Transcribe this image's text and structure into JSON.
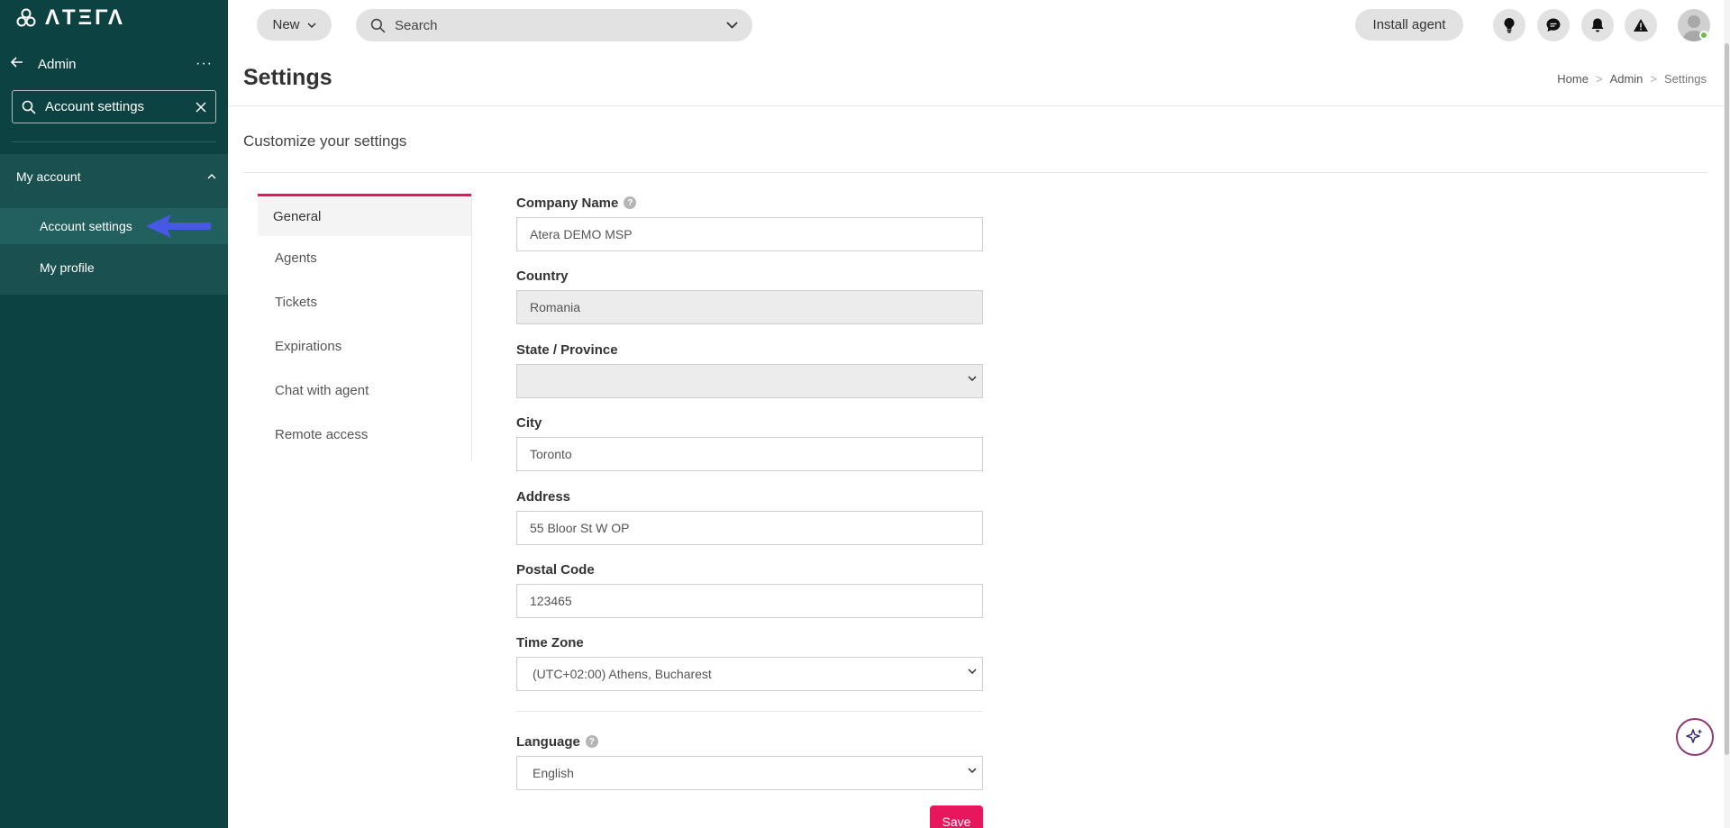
{
  "sidebar": {
    "logo_text": "ΛTΞΓΛ",
    "section_title": "Admin",
    "search_value": "Account settings",
    "group_label": "My account",
    "items": [
      {
        "label": "Account settings",
        "active": true
      },
      {
        "label": "My profile",
        "active": false
      }
    ]
  },
  "topbar": {
    "new_label": "New",
    "search_placeholder": "Search",
    "install_label": "Install agent",
    "icons": [
      "lightbulb-icon",
      "chat-icon",
      "bell-icon",
      "alert-icon"
    ]
  },
  "header": {
    "title": "Settings",
    "breadcrumb": [
      "Home",
      "Admin",
      "Settings"
    ]
  },
  "content": {
    "subtitle": "Customize your settings",
    "tabs": [
      "General",
      "Agents",
      "Tickets",
      "Expirations",
      "Chat with agent",
      "Remote access"
    ],
    "active_tab": "General",
    "form": {
      "company_name": {
        "label": "Company Name",
        "value": "Atera DEMO MSP"
      },
      "country": {
        "label": "Country",
        "value": "Romania"
      },
      "state": {
        "label": "State / Province",
        "value": ""
      },
      "city": {
        "label": "City",
        "value": "Toronto"
      },
      "address": {
        "label": "Address",
        "value": "55 Bloor St W OP"
      },
      "postal_code": {
        "label": "Postal Code",
        "value": "123465"
      },
      "time_zone": {
        "label": "Time Zone",
        "value": "(UTC+02:00) Athens, Bucharest"
      },
      "language": {
        "label": "Language",
        "value": "English"
      }
    },
    "save_label": "Save"
  },
  "colors": {
    "sidebar_bg": "#0c4342",
    "accent": "#e8175d",
    "annotation_arrow": "#4757e6"
  }
}
